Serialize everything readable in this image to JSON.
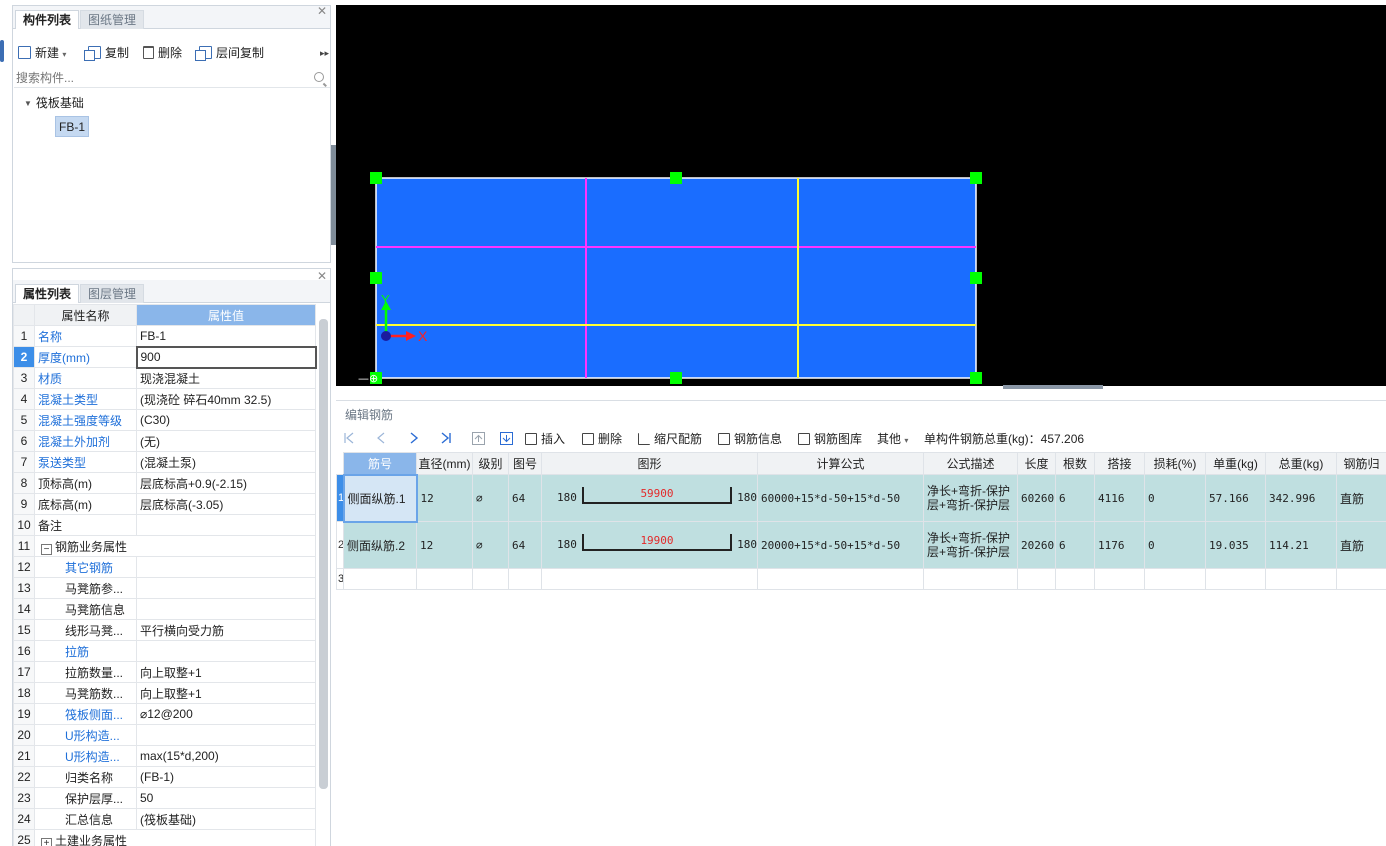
{
  "component_panel": {
    "tabs": [
      "构件列表",
      "图纸管理"
    ],
    "toolbar": {
      "new": "新建",
      "copy": "复制",
      "delete": "删除",
      "floor_copy": "层间复制"
    },
    "search_placeholder": "搜索构件...",
    "tree": {
      "root": "筏板基础",
      "child": "FB-1"
    }
  },
  "property_panel": {
    "tabs": [
      "属性列表",
      "图层管理"
    ],
    "headers": {
      "name": "属性名称",
      "value": "属性值"
    },
    "rows": [
      {
        "n": "1",
        "name": "名称",
        "value": "FB-1"
      },
      {
        "n": "2",
        "name": "厚度(mm)",
        "value": "900"
      },
      {
        "n": "3",
        "name": "材质",
        "value": "现浇混凝土"
      },
      {
        "n": "4",
        "name": "混凝土类型",
        "value": "(现浇砼 碎石40mm 32.5)"
      },
      {
        "n": "5",
        "name": "混凝土强度等级",
        "value": "(C30)"
      },
      {
        "n": "6",
        "name": "混凝土外加剂",
        "value": "(无)"
      },
      {
        "n": "7",
        "name": "泵送类型",
        "value": "(混凝土泵)"
      },
      {
        "n": "8",
        "name": "顶标高(m)",
        "value": "层底标高+0.9(-2.15)"
      },
      {
        "n": "9",
        "name": "底标高(m)",
        "value": "层底标高(-3.05)"
      },
      {
        "n": "10",
        "name": "备注",
        "value": ""
      },
      {
        "n": "11",
        "name": "钢筋业务属性",
        "value": ""
      },
      {
        "n": "12",
        "name": "其它钢筋",
        "value": ""
      },
      {
        "n": "13",
        "name": "马凳筋参...",
        "value": ""
      },
      {
        "n": "14",
        "name": "马凳筋信息",
        "value": ""
      },
      {
        "n": "15",
        "name": "线形马凳...",
        "value": "平行横向受力筋"
      },
      {
        "n": "16",
        "name": "拉筋",
        "value": ""
      },
      {
        "n": "17",
        "name": "拉筋数量...",
        "value": "向上取整+1"
      },
      {
        "n": "18",
        "name": "马凳筋数...",
        "value": "向上取整+1"
      },
      {
        "n": "19",
        "name": "筏板侧面...",
        "value": "⌀12@200"
      },
      {
        "n": "20",
        "name": "U形构造...",
        "value": ""
      },
      {
        "n": "21",
        "name": "U形构造...",
        "value": "max(15*d,200)"
      },
      {
        "n": "22",
        "name": "归类名称",
        "value": "(FB-1)"
      },
      {
        "n": "23",
        "name": "保护层厚...",
        "value": "50"
      },
      {
        "n": "24",
        "name": "汇总信息",
        "value": "(筏板基础)"
      },
      {
        "n": "25",
        "name": "土建业务属性",
        "value": ""
      }
    ]
  },
  "canvas": {
    "axis_x": "X",
    "axis_y": "Y"
  },
  "rebar_editor": {
    "title": "编辑钢筋",
    "toolbar": {
      "insert": "插入",
      "delete": "删除",
      "scale": "缩尺配筋",
      "info": "钢筋信息",
      "library": "钢筋图库",
      "other": "其他"
    },
    "total_weight": "单构件钢筋总重(kg)：457.206",
    "headers": [
      "筋号",
      "直径(mm)",
      "级别",
      "图号",
      "图形",
      "计算公式",
      "公式描述",
      "长度",
      "根数",
      "搭接",
      "损耗(%)",
      "单重(kg)",
      "总重(kg)",
      "钢筋归"
    ],
    "rows": [
      {
        "n": "1",
        "name": "侧面纵筋.1",
        "dia": "12",
        "grade": "⌀",
        "fig": "64",
        "left": "180",
        "mid": "59900",
        "right": "180",
        "formula": "60000+15*d-50+15*d-50",
        "desc": "净长+弯折-保护层+弯折-保护层",
        "len": "60260",
        "count": "6",
        "lap": "4116",
        "loss": "0",
        "unit": "57.166",
        "total": "342.996",
        "cat": "直筋"
      },
      {
        "n": "2",
        "name": "侧面纵筋.2",
        "dia": "12",
        "grade": "⌀",
        "fig": "64",
        "left": "180",
        "mid": "19900",
        "right": "180",
        "formula": "20000+15*d-50+15*d-50",
        "desc": "净长+弯折-保护层+弯折-保护层",
        "len": "20260",
        "count": "6",
        "lap": "1176",
        "loss": "0",
        "unit": "19.035",
        "total": "114.21",
        "cat": "直筋"
      }
    ],
    "empty_row": "3"
  },
  "colors": {
    "slab_fill": "#1a6dff",
    "handle": "#00ff00",
    "magenta_line": "#ff33ff",
    "yellow_line": "#ffff33",
    "header_blue": "#8ab6ea",
    "row_fill": "#bfdfe0"
  }
}
